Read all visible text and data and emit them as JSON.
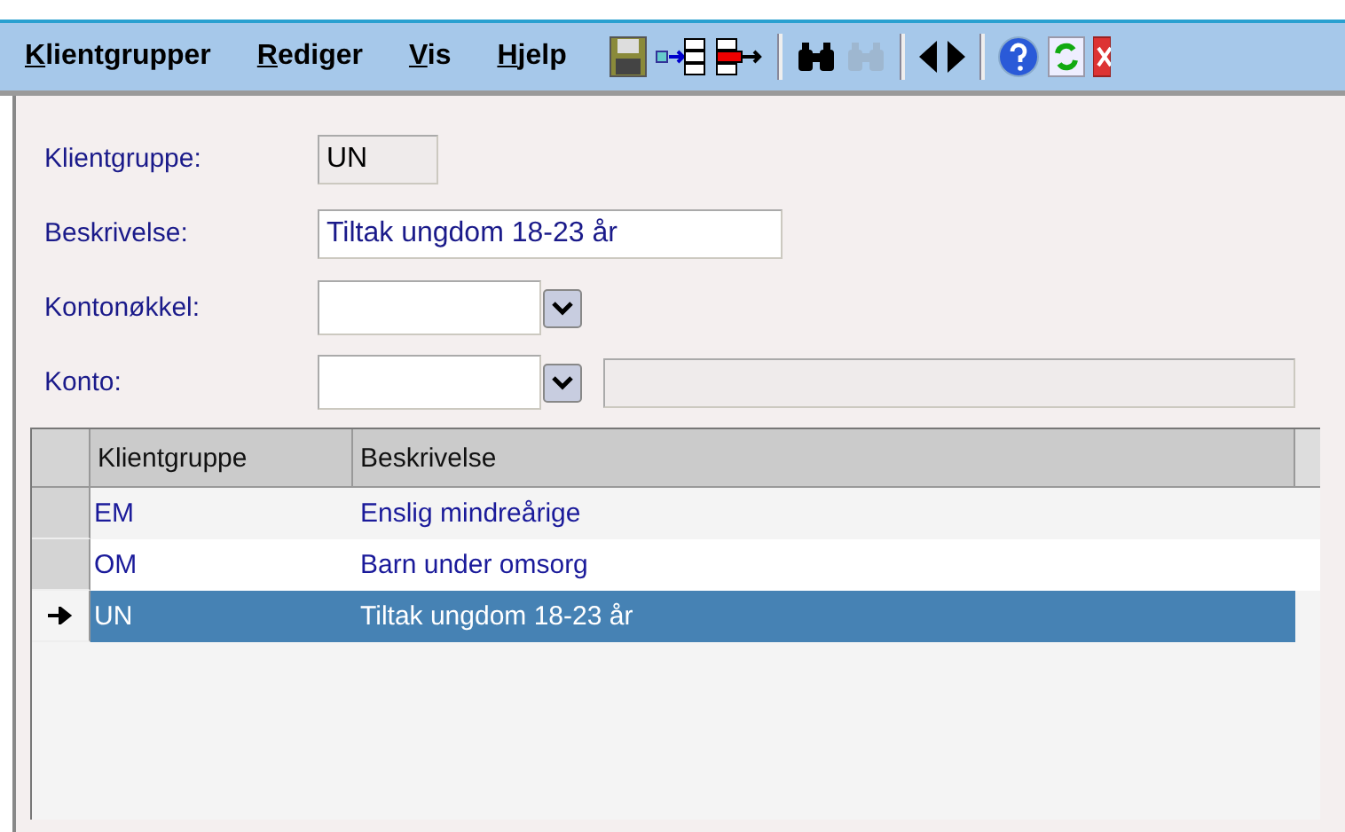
{
  "menu": [
    {
      "label": "Klientgrupper"
    },
    {
      "label": "Rediger"
    },
    {
      "label": "Vis"
    },
    {
      "label": "Hjelp"
    }
  ],
  "toolbar": [
    {
      "kind": "save"
    },
    {
      "kind": "flow-in"
    },
    {
      "kind": "flow-out"
    },
    {
      "kind": "sep"
    },
    {
      "kind": "find",
      "disabled": false
    },
    {
      "kind": "find",
      "disabled": true
    },
    {
      "kind": "sep"
    },
    {
      "kind": "prev"
    },
    {
      "kind": "next"
    },
    {
      "kind": "sep"
    },
    {
      "kind": "help"
    },
    {
      "kind": "refresh"
    },
    {
      "kind": "close"
    }
  ],
  "form": [
    {
      "kind": "readonly",
      "label": "Klientgruppe:",
      "value": "UN"
    },
    {
      "kind": "text",
      "label": "Beskrivelse:",
      "value": "Tiltak ungdom 18-23 år"
    },
    {
      "kind": "combo",
      "label": "Kontonøkkel:"
    },
    {
      "kind": "combo-extra",
      "label": "Konto:"
    }
  ],
  "table": {
    "columns": [
      "Klientgruppe",
      "Beskrivelse"
    ],
    "rows": [
      {
        "cells": [
          "EM",
          "Enslig mindreårige"
        ],
        "selected": false
      },
      {
        "cells": [
          "OM",
          "Barn under omsorg"
        ],
        "selected": false
      },
      {
        "cells": [
          "UN",
          "Tiltak ungdom 18-23 år"
        ],
        "selected": true
      }
    ]
  }
}
